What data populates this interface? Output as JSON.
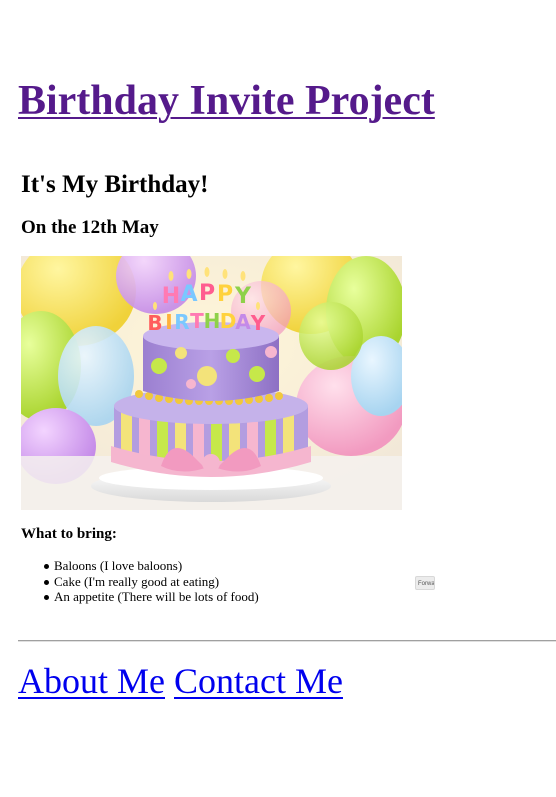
{
  "page": {
    "title": "Birthday Invite Project"
  },
  "invite": {
    "heading": "It's My Birthday!",
    "date": "On the 12th May",
    "cake_image": {
      "candle_letters": "HAPPY BIRTHDAY"
    },
    "bring_heading": "What to bring:",
    "bring_items": [
      "Baloons (I love baloons)",
      "Cake (I'm really good at eating)",
      "An appetite (There will be lots of food)"
    ],
    "forward_button": "Forward"
  },
  "nav": {
    "about": "About Me",
    "contact": "Contact Me"
  },
  "colors": {
    "visited_link": "#551a8b",
    "link": "#0000ee",
    "cake_purple": "#a98bd6",
    "balloon_green": "#c6e84a",
    "balloon_yellow": "#f5e35a",
    "ribbon_pink": "#f5b6cf"
  }
}
